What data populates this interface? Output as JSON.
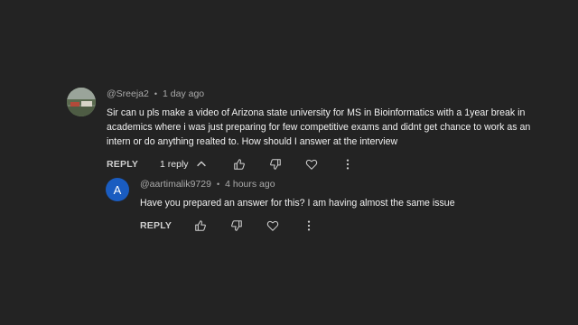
{
  "comments": [
    {
      "handle": "@Sreeja2",
      "time": "1 day ago",
      "text": "Sir can u pls make a video of Arizona state university for MS in Bioinformatics with a 1year break in academics where i was just preparing for few competitive exams and didnt get chance to work as an intern or do anything realted to. How should I answer at the interview",
      "reply_label": "REPLY",
      "replies_label": "1 reply"
    }
  ],
  "reply": {
    "avatar_letter": "A",
    "handle": "@aartimalik9729",
    "time": "4 hours ago",
    "text": "Have you prepared an answer for this? I am having almost the same issue",
    "reply_label": "REPLY"
  },
  "meta_separator": "•",
  "icons": [
    "thumbs-up-icon",
    "thumbs-down-icon",
    "heart-icon",
    "more-vert-icon",
    "chevron-up-icon"
  ]
}
